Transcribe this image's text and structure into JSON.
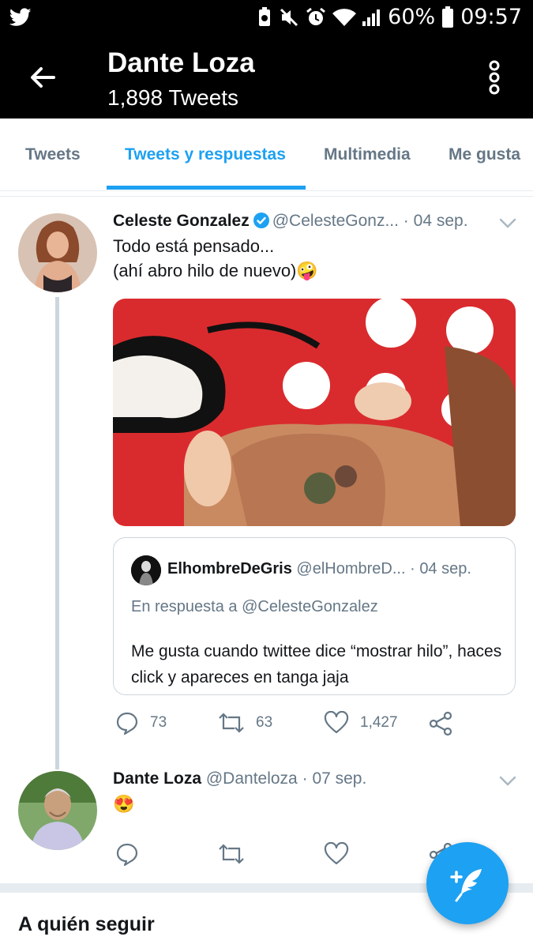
{
  "status_bar": {
    "battery_percent": "60%",
    "time": "09:57",
    "icons": [
      "twitter-bird-icon",
      "data-saver-icon",
      "mute-icon",
      "alarm-icon",
      "wifi-icon",
      "signal-icon",
      "battery-icon"
    ]
  },
  "header": {
    "title": "Dante Loza",
    "subtitle": "1,898 Tweets"
  },
  "tabs": [
    {
      "label": "Tweets",
      "active": false
    },
    {
      "label": "Tweets y respuestas",
      "active": true
    },
    {
      "label": "Multimedia",
      "active": false
    },
    {
      "label": "Me gusta",
      "active": false
    }
  ],
  "tweets": [
    {
      "author_name": "Celeste Gonzalez",
      "verified": true,
      "handle": "@CelesteGonz...",
      "separator": "·",
      "date": "04 sep.",
      "text_lines": [
        "Todo está pensado...",
        "(ahí abro hilo de nuevo)🤪"
      ],
      "quote": {
        "author_name": "ElhombreDeGris",
        "handle": "@elHombreD...",
        "separator": "·",
        "date": "04 sep.",
        "reply_to": "En respuesta a @CelesteGonzalez",
        "text": "Me gusta cuando twittee dice “mostrar hilo”, haces click y apareces en tanga jaja"
      },
      "actions": {
        "replies": "73",
        "retweets": "63",
        "likes": "1,427"
      }
    },
    {
      "author_name": "Dante Loza",
      "handle": "@Danteloza",
      "separator": "·",
      "date": "07 sep.",
      "text": "😍"
    }
  ],
  "who_to_follow": {
    "title": "A quién seguir"
  },
  "colors": {
    "accent": "#1da1f2",
    "secondary_text": "#657786",
    "appbar": "#000000"
  }
}
